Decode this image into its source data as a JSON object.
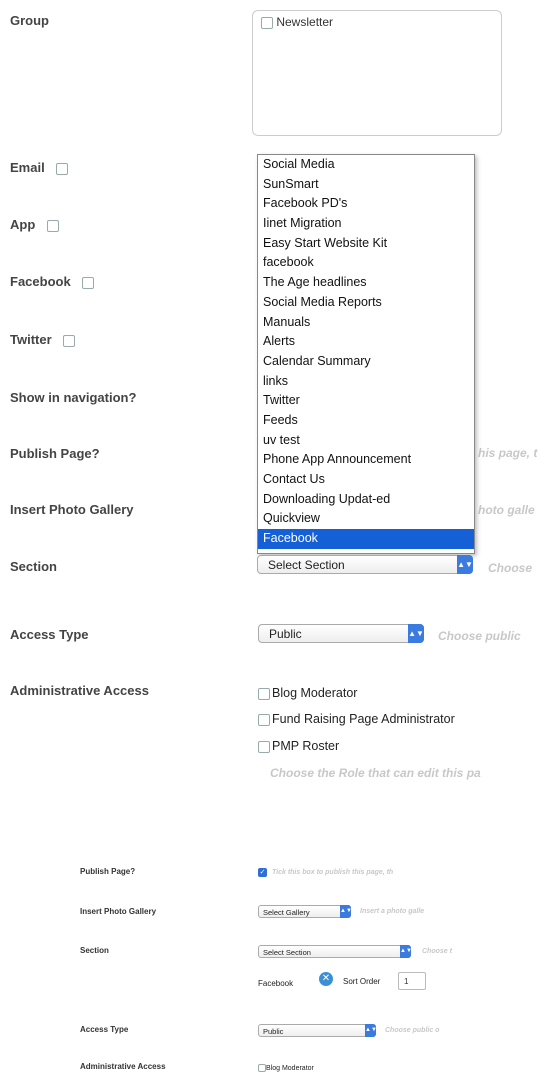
{
  "labels": {
    "group": "Group",
    "email": "Email",
    "app": "App",
    "facebook": "Facebook",
    "twitter": "Twitter",
    "show_nav": "Show in navigation?",
    "publish": "Publish Page?",
    "gallery": "Insert Photo Gallery",
    "section": "Section",
    "access": "Access Type",
    "admin": "Administrative Access"
  },
  "group": {
    "option": "Newsletter"
  },
  "section_dropdown": {
    "options": [
      "Social Media",
      "SunSmart",
      "Facebook PD's",
      "Iinet Migration",
      "Easy Start Website Kit",
      "facebook",
      "The Age headlines",
      "Social Media Reports",
      "Manuals",
      "Alerts",
      "Calendar Summary",
      "links",
      "Twitter",
      "Feeds",
      "uv test",
      "Phone App Announcement",
      "Contact Us",
      "Downloading Updat-ed",
      "Quickview",
      "Facebook"
    ],
    "selected_index": 19,
    "value": "Select Section"
  },
  "hints": {
    "publish": "his page, t",
    "gallery": "hoto galle",
    "section": "Choose",
    "access": "Choose public",
    "admin": "Choose the Role that can edit this pa"
  },
  "access": {
    "value": "Public"
  },
  "admin_roles": [
    "Blog Moderator",
    "Fund Raising Page Administrator",
    "PMP Roster"
  ],
  "thumb": {
    "publish_label": "Publish Page?",
    "publish_hint": "Tick this box to publish this page, th",
    "gallery_label": "Insert Photo Gallery",
    "gallery_value": "Select Gallery",
    "gallery_hint": "Insert a photo galle",
    "section_label": "Section",
    "section_value": "Select Section",
    "section_hint": "Choose t",
    "facebook_text": "Facebook",
    "sort_label": "Sort Order",
    "sort_value": "1",
    "access_label": "Access Type",
    "access_value": "Public",
    "access_hint": "Choose public o",
    "admin_label": "Administrative Access",
    "admin_first": "Blog Moderator"
  }
}
